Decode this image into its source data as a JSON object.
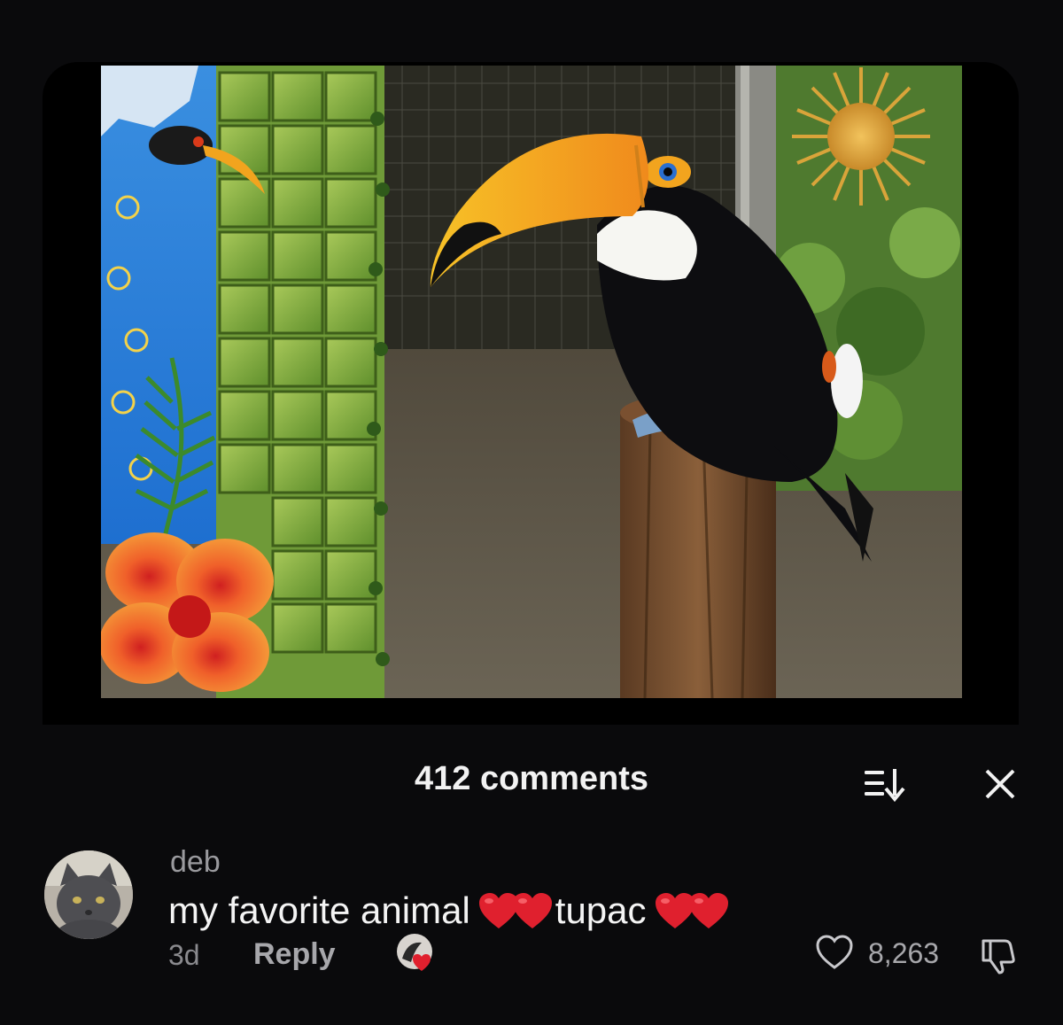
{
  "comments_header": {
    "count_label": "412 comments"
  },
  "comment": {
    "username": "deb",
    "text_part1": "my favorite animal ",
    "text_part2": "tupac ",
    "timestamp": "3d",
    "reply_label": "Reply",
    "like_count": "8,263"
  },
  "icons": {
    "sort": "sort-icon",
    "close": "close-icon",
    "heart": "heart-outline-icon",
    "dislike": "thumbs-down-icon",
    "emoji": "red-heart-emoji"
  },
  "colors": {
    "background": "#0a0a0c",
    "heart_red": "#e0202e",
    "toucan_beak": "#f5a623"
  }
}
